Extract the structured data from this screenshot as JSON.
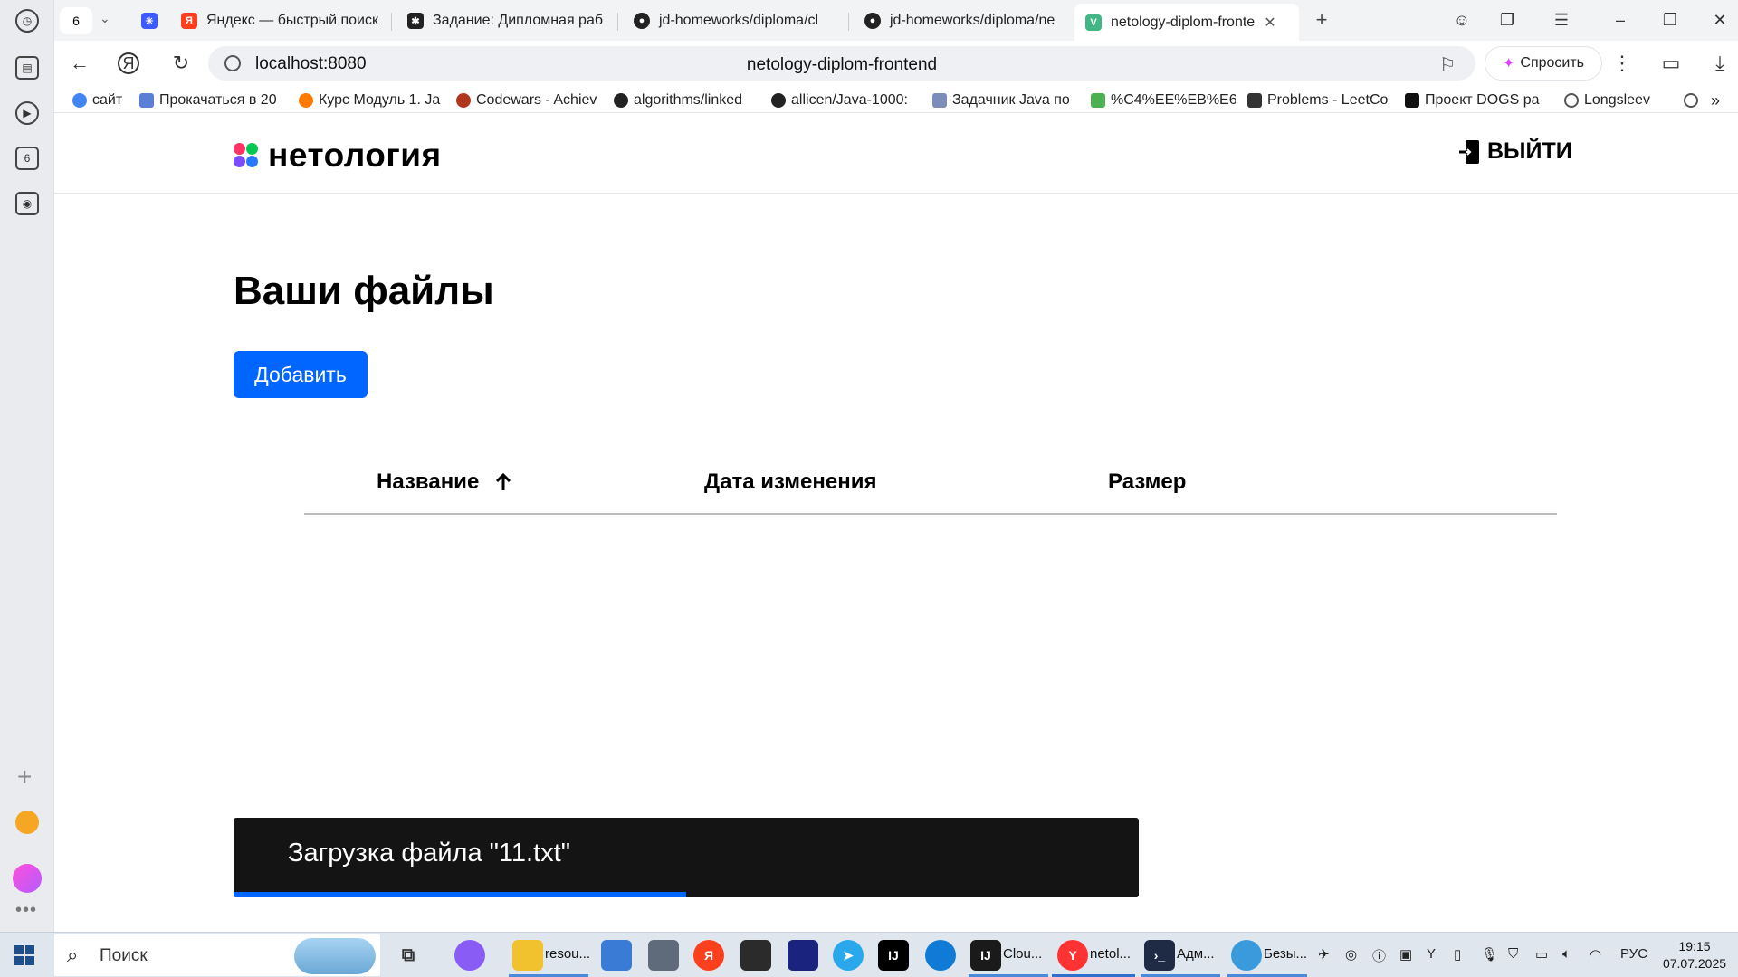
{
  "browser": {
    "tab_counter": "6",
    "tabs": [
      {
        "title": "",
        "favicon_color": "#3d5afe"
      },
      {
        "title": "Яндекс — быстрый поиск",
        "favicon_color": "#fc3f1d"
      },
      {
        "title": "Задание: Дипломная раб",
        "favicon_color": "#222222"
      },
      {
        "title": "jd-homeworks/diploma/cl",
        "favicon_color": "#222222"
      },
      {
        "title": "jd-homeworks/diploma/ne",
        "favicon_color": "#222222"
      },
      {
        "title": "netology-diplom-fronte",
        "favicon_color": "#41b883"
      }
    ],
    "url": "localhost:8080",
    "page_title": "netology-diplom-frontend",
    "ask_label": "Спросить",
    "bookmarks": [
      {
        "label": "сайт",
        "color": "#4285f4"
      },
      {
        "label": "Прокачаться в 20",
        "color": "#5b7fd6"
      },
      {
        "label": "Курс Модуль 1. Ja",
        "color": "#ff7a00"
      },
      {
        "label": "Codewars - Achiev",
        "color": "#b1361e"
      },
      {
        "label": "algorithms/linked",
        "color": "#222222"
      },
      {
        "label": "allicen/Java-1000:",
        "color": "#222222"
      },
      {
        "label": "Задачник Java по",
        "color": "#7b8db8"
      },
      {
        "label": "%C4%EE%EB%E6%",
        "color": "#4caf50"
      },
      {
        "label": "Problems - LeetCo",
        "color": "#333333"
      },
      {
        "label": "Проект DOGS ра",
        "color": "#111111"
      },
      {
        "label": "Longsleev",
        "color": "#555555"
      }
    ]
  },
  "site": {
    "logo_text": "нетология",
    "logout_label": "ВЫЙТИ",
    "heading": "Ваши файлы",
    "add_button": "Добавить",
    "table": {
      "columns": [
        "Название",
        "Дата изменения",
        "Размер"
      ],
      "sort_indicator": "arrow-up-icon",
      "rows": []
    },
    "toast": {
      "text": "Загрузка файла \"11.txt\"",
      "progress": 0.5
    },
    "colors": {
      "accent": "#0066ff",
      "toast_bg": "#141414"
    }
  },
  "taskbar": {
    "search_placeholder": "Поиск",
    "apps": [
      {
        "label": "resou...",
        "color": "#f2c12e"
      },
      {
        "label": "Clou...",
        "color": "#1a1a1a"
      },
      {
        "label": "netol...",
        "color": "#ff3333"
      },
      {
        "label": "Адм...",
        "color": "#1f2a44"
      },
      {
        "label": "Безы...",
        "color": "#3a9bdc"
      }
    ],
    "language": "РУС",
    "time": "19:15",
    "date": "07.07.2025"
  }
}
